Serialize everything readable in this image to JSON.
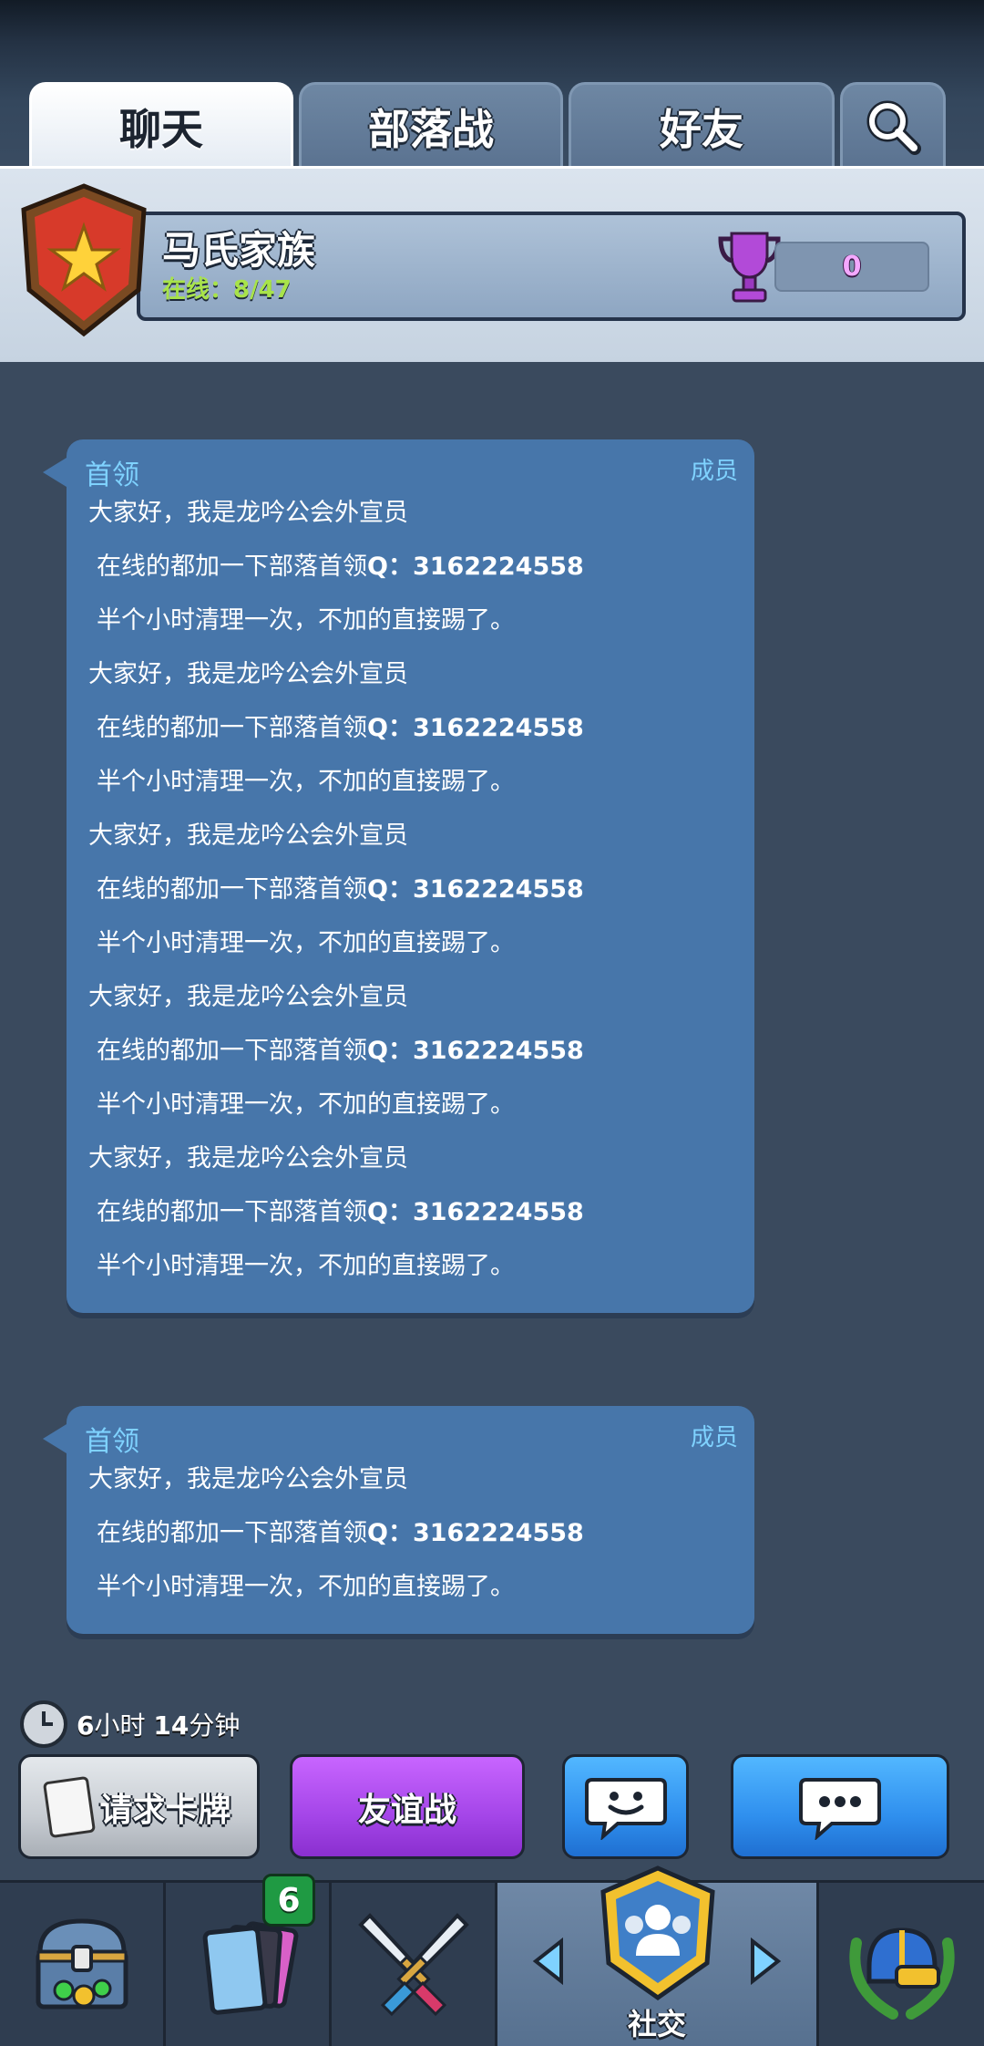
{
  "tabs": [
    {
      "label": "聊天",
      "active": true
    },
    {
      "label": "部落战",
      "active": false
    },
    {
      "label": "好友",
      "active": false
    }
  ],
  "clan": {
    "name": "马氏家族",
    "online_label": "在线：8/47",
    "trophies": "0"
  },
  "messages": [
    {
      "role": "首领",
      "rank": "成员",
      "lines": [
        {
          "pre": "大家好，我是龙吟公会外宣员 ",
          "bold": "",
          "post": "",
          "indent": false
        },
        {
          "pre": "在线的都加一下部落首领",
          "bold": "Q：3162224558",
          "post": "",
          "indent": true
        },
        {
          "pre": "半个小时清理一次，不加的直接踢了。",
          "bold": "",
          "post": "",
          "indent": true
        },
        {
          "pre": "大家好，我是龙吟公会外宣员 ",
          "bold": "",
          "post": "",
          "indent": false
        },
        {
          "pre": "在线的都加一下部落首领",
          "bold": "Q：3162224558",
          "post": "",
          "indent": true
        },
        {
          "pre": "半个小时清理一次，不加的直接踢了。",
          "bold": "",
          "post": "",
          "indent": true
        },
        {
          "pre": "大家好，我是龙吟公会外宣员 ",
          "bold": "",
          "post": "",
          "indent": false
        },
        {
          "pre": "在线的都加一下部落首领",
          "bold": "Q：3162224558",
          "post": "",
          "indent": true
        },
        {
          "pre": "半个小时清理一次，不加的直接踢了。",
          "bold": "",
          "post": "",
          "indent": true
        },
        {
          "pre": "大家好，我是龙吟公会外宣员 ",
          "bold": "",
          "post": "",
          "indent": false
        },
        {
          "pre": "在线的都加一下部落首领",
          "bold": "Q：3162224558",
          "post": "",
          "indent": true
        },
        {
          "pre": "半个小时清理一次，不加的直接踢了。",
          "bold": "",
          "post": "",
          "indent": true
        },
        {
          "pre": "大家好，我是龙吟公会外宣员 ",
          "bold": "",
          "post": "",
          "indent": false
        },
        {
          "pre": "在线的都加一下部落首领",
          "bold": "Q：3162224558",
          "post": "",
          "indent": true
        },
        {
          "pre": "半个小时清理一次，不加的直接踢了。",
          "bold": "",
          "post": "",
          "indent": true
        }
      ]
    },
    {
      "role": "首领",
      "rank": "成员",
      "lines": [
        {
          "pre": "大家好，我是龙吟公会外宣员 ",
          "bold": "",
          "post": "",
          "indent": false
        },
        {
          "pre": "在线的都加一下部落首领",
          "bold": "Q：3162224558",
          "post": "",
          "indent": true
        },
        {
          "pre": "半个小时清理一次，不加的直接踢了。",
          "bold": "",
          "post": "",
          "indent": true
        }
      ]
    }
  ],
  "timer": {
    "hours": "6",
    "hours_unit": "小时 ",
    "minutes": "14",
    "minutes_unit": "分钟"
  },
  "buttons": {
    "request_cards": "请求卡牌",
    "friendly_battle": "友谊战"
  },
  "nav": {
    "cards_badge": "6",
    "social_label": "社交",
    "items": [
      "chest-icon",
      "cards-icon",
      "battle-swords-icon",
      "social-icon",
      "helmet-laurel-icon"
    ]
  },
  "colors": {
    "background": "#3a4a5e",
    "bubble": "#4776aa",
    "role_text": "#7fd2ff",
    "online_text": "#a8e34a",
    "friendly_button": "#a445e8",
    "chat_button": "#2f8fee"
  }
}
